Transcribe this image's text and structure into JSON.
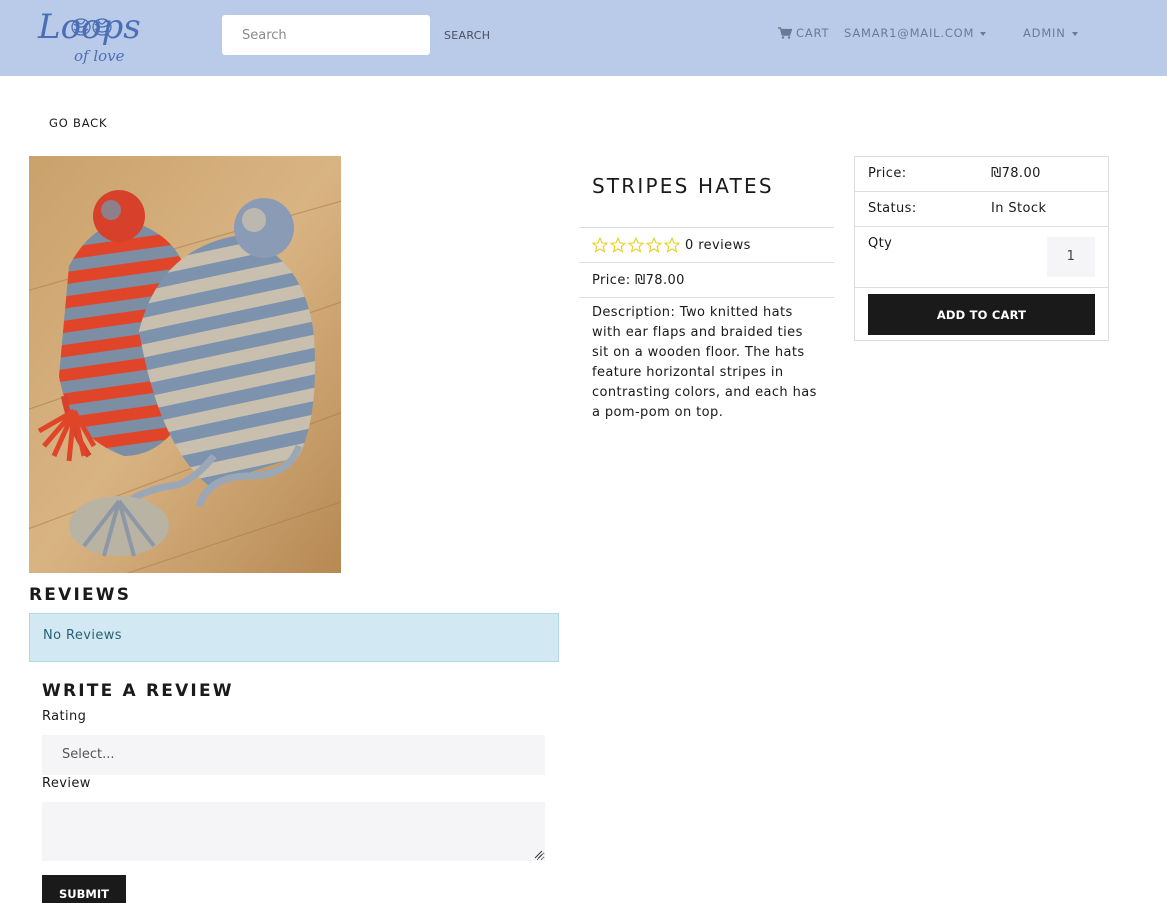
{
  "navbar": {
    "logo_line1": "Loops",
    "logo_line2": "of love",
    "search_placeholder": "Search",
    "search_label": "SEARCH",
    "cart_label": "CART",
    "user_label": "SAMAR1@MAIL.COM",
    "admin_label": "ADMIN"
  },
  "page": {
    "go_back_label": "GO BACK"
  },
  "product": {
    "name": "STRIPES HATES",
    "rating_stars": 0,
    "reviews_text": "0 reviews",
    "price_text": "Price: ₪78.00",
    "description": "Description: Two knitted hats with ear flaps and braided ties sit on a wooden floor. The hats feature horizontal stripes in contrasting colors, and each has a pom-pom on top."
  },
  "summary": {
    "price_label": "Price:",
    "price_value": "₪78.00",
    "status_label": "Status:",
    "status_value": "In Stock",
    "qty_label": "Qty",
    "qty_value": "1",
    "add_to_cart_label": "ADD TO CART"
  },
  "reviews": {
    "heading": "REVIEWS",
    "empty_message": "No Reviews",
    "write_heading": "WRITE A REVIEW",
    "rating_label": "Rating",
    "rating_placeholder": "Select...",
    "review_label": "Review",
    "submit_label": "SUBMIT"
  },
  "colors": {
    "navbar_bg": "#bacbea",
    "logo_color": "#4a6fb5",
    "star_color": "#f8e825",
    "alert_bg": "#d2e9f4",
    "button_bg": "#1a1a1a"
  }
}
